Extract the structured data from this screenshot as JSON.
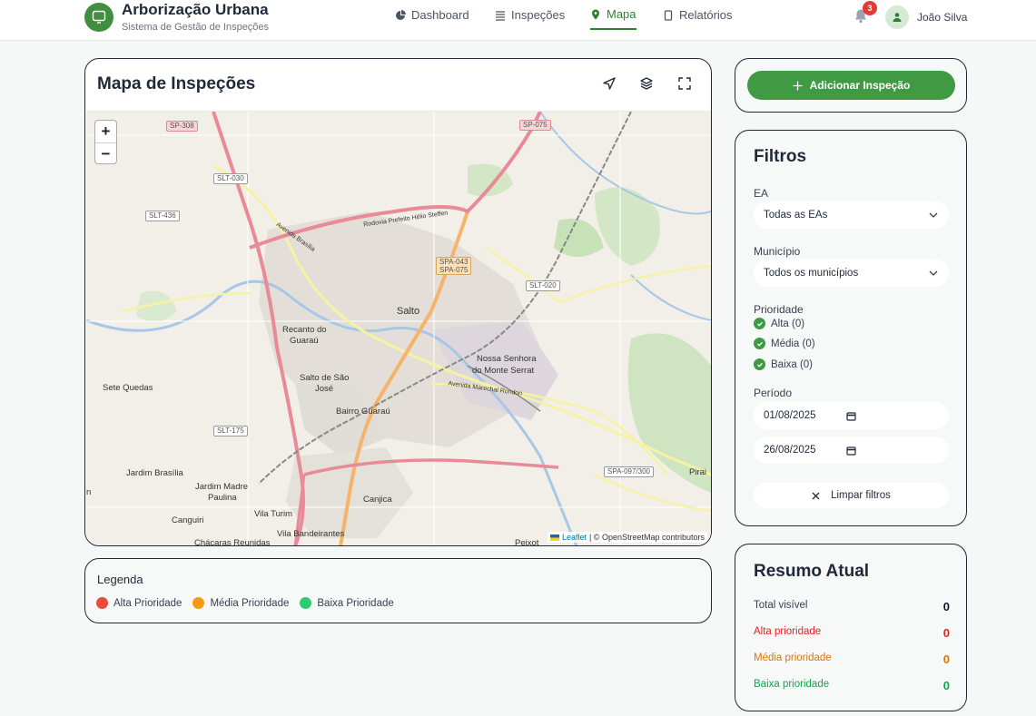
{
  "app": {
    "title": "Arborização Urbana",
    "subtitle": "Sistema de Gestão de Inspeções"
  },
  "nav": [
    {
      "label": "Dashboard",
      "icon": "pie-chart-icon",
      "active": false
    },
    {
      "label": "Inspeções",
      "icon": "list-icon",
      "active": false
    },
    {
      "label": "Mapa",
      "icon": "map-pin-icon",
      "active": true
    },
    {
      "label": "Relatórios",
      "icon": "document-icon",
      "active": false
    }
  ],
  "notifications": {
    "count": "3"
  },
  "user": {
    "name": "João Silva"
  },
  "map": {
    "title": "Mapa de Inspeções",
    "tools": [
      "locate-icon",
      "layers-icon",
      "fullscreen-icon"
    ],
    "zoom_in": "+",
    "zoom_out": "−",
    "attribution_link": "Leaflet",
    "attribution_text": "| © OpenStreetMap contributors",
    "places": [
      "Salto",
      "Recanto do",
      "Guaraú",
      "Salto de São",
      "José",
      "Nossa Senhora",
      "do Monte Serrat",
      "Sete Quedas",
      "Bairro Guaraú",
      "Jardim Brasília",
      "Jardim Madre",
      "Paulina",
      "Canjica",
      "Vila Turim",
      "Canguiri",
      "Vila Bandeirantes",
      "Chácaras Reunidas",
      "Pirai",
      "Peixot",
      "n"
    ],
    "roads": [
      "SP-308",
      "SP-075",
      "SLT-030",
      "SLT-436",
      "SLT-020",
      "SLT-175",
      "SPA-097/300",
      "SPA-043",
      "SPA-075",
      "Rodovia Prefeito Hélio Steffen",
      "Avenida Marechal Rondon",
      "Avenida Brasília"
    ]
  },
  "legend": {
    "title": "Legenda",
    "items": [
      {
        "label": "Alta Prioridade",
        "color": "#e74c3c"
      },
      {
        "label": "Média Prioridade",
        "color": "#f39c12"
      },
      {
        "label": "Baixa Prioridade",
        "color": "#2ecc71"
      }
    ]
  },
  "actions": {
    "add_label": "Adicionar Inspeção"
  },
  "filters": {
    "title": "Filtros",
    "ea_label": "EA",
    "ea_value": "Todas as EAs",
    "municipio_label": "Município",
    "municipio_value": "Todos os municípios",
    "prioridade_label": "Prioridade",
    "prioridades": [
      "Alta (0)",
      "Média (0)",
      "Baixa (0)"
    ],
    "periodo_label": "Período",
    "date_start": "01/08/2025",
    "date_end": "26/08/2025",
    "clear_label": "Limpar filtros"
  },
  "summary": {
    "title": "Resumo Atual",
    "rows": [
      {
        "label": "Total visível",
        "value": "0",
        "color": "#374151"
      },
      {
        "label": "Alta prioridade",
        "value": "0",
        "color": "#dc2626"
      },
      {
        "label": "Média prioridade",
        "value": "0",
        "color": "#d97706"
      },
      {
        "label": "Baixa prioridade",
        "value": "0",
        "color": "#16a34a"
      }
    ]
  }
}
